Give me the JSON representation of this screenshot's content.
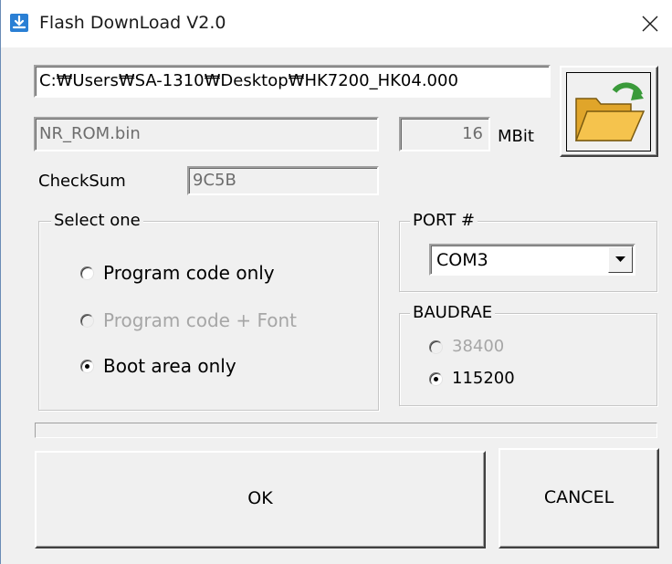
{
  "window": {
    "title": "Flash DownLoad V2.0",
    "app_icon": "download-arrow-icon",
    "close_icon": "close-icon"
  },
  "file": {
    "path": "C:₩Users₩SA-1310₩Desktop₩HK7200_HK04.000",
    "name": "NR_ROM.bin",
    "size": "16",
    "size_unit": "MBit",
    "checksum_label": "CheckSum",
    "checksum": "9C5B",
    "browse_icon": "open-folder-icon"
  },
  "select_group": {
    "title": "Select one",
    "options": [
      {
        "label": "Program code only",
        "selected": false,
        "enabled": true
      },
      {
        "label": "Program code + Font",
        "selected": false,
        "enabled": false
      },
      {
        "label": "Boot area only",
        "selected": true,
        "enabled": true
      }
    ]
  },
  "port_group": {
    "title": "PORT #",
    "selected": "COM3"
  },
  "baud_group": {
    "title": "BAUDRAE",
    "options": [
      {
        "label": "38400",
        "selected": false,
        "enabled": false
      },
      {
        "label": "115200",
        "selected": true,
        "enabled": true
      }
    ]
  },
  "progress": {
    "value": 0
  },
  "buttons": {
    "ok": "OK",
    "cancel": "CANCEL"
  },
  "colors": {
    "title_icon": "#2a7fd4",
    "folder_fill": "#f5c34d",
    "folder_arrow": "#3a9a3a",
    "disabled_text": "#a6a6a6"
  }
}
